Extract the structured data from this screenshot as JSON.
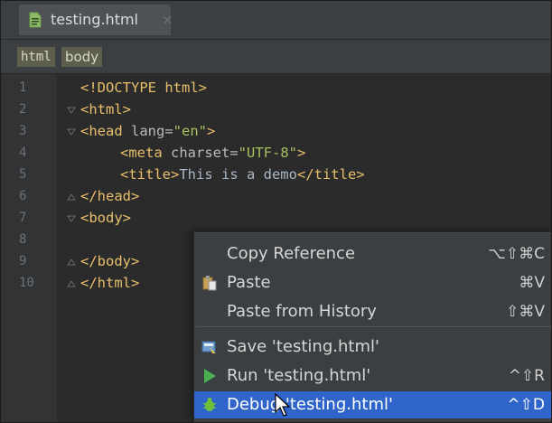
{
  "tab": {
    "label": "testing.html",
    "close": "×"
  },
  "breadcrumbs": [
    "html",
    "body"
  ],
  "line_numbers": [
    "1",
    "2",
    "3",
    "4",
    "5",
    "6",
    "7",
    "8",
    "9",
    "10"
  ],
  "code": {
    "l1": {
      "tag": "<!DOCTYPE html>"
    },
    "l2": {
      "tag": "<html>"
    },
    "l3": {
      "tag_open": "<head ",
      "attr": "lang=",
      "val": "\"en\"",
      "tag_close": ">"
    },
    "l4": {
      "tag_open": "<meta ",
      "attr": "charset=",
      "val": "\"UTF-8\"",
      "tag_close": ">"
    },
    "l5": {
      "tag_open": "<title>",
      "text": "This is a demo",
      "tag_close": "</title>"
    },
    "l6": {
      "tag": "</head>"
    },
    "l7": {
      "tag": "<body>"
    },
    "l9": {
      "tag": "</body>"
    },
    "l10": {
      "tag": "</html>"
    }
  },
  "context_menu": {
    "items": [
      {
        "label": "Copy Reference",
        "shortcut": "⌥⇧⌘C",
        "icon": "none"
      },
      {
        "label": "Paste",
        "shortcut": "⌘V",
        "icon": "paste-icon"
      },
      {
        "label": "Paste from History",
        "shortcut": "⇧⌘V",
        "icon": "none"
      },
      {
        "label": "Save 'testing.html'",
        "shortcut": "",
        "icon": "save-icon"
      },
      {
        "label": "Run 'testing.html'",
        "shortcut": "^⇧R",
        "icon": "run-icon"
      },
      {
        "label": "Debug 'testing.html'",
        "shortcut": "^⇧D",
        "icon": "debug-icon"
      }
    ],
    "selected_index": 5
  },
  "colors": {
    "selection": "#2f65ca",
    "tag": "#e8bf6a",
    "attr_value": "#a5c25c",
    "run_green": "#4caf50"
  }
}
